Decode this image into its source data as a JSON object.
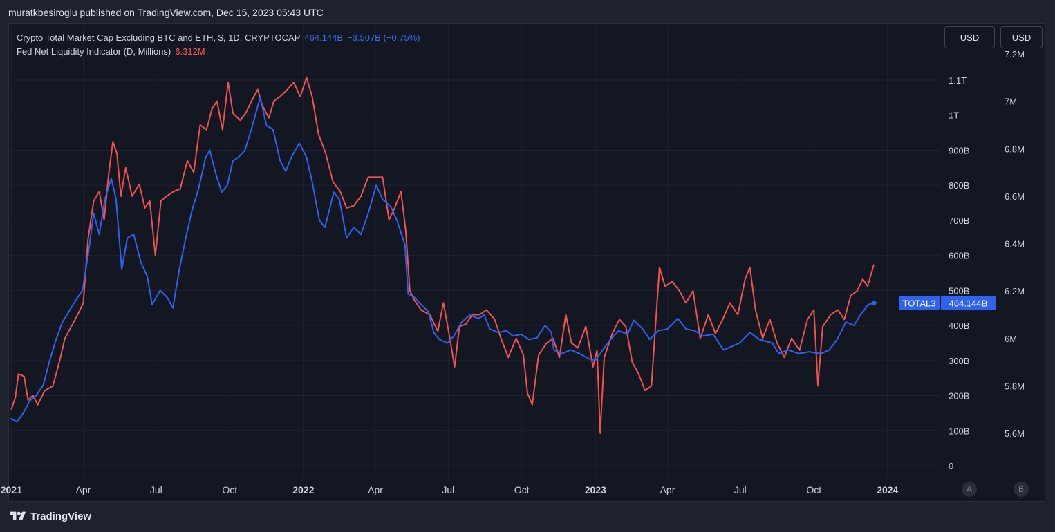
{
  "header": {
    "published": "muratkbesiroglu published on TradingView.com, Dec 15, 2023 05:43 UTC"
  },
  "legend": {
    "total3_name": "Crypto Total Market Cap Excluding BTC and ETH, $, 1D, CRYPTOCAP",
    "total3_value": "464.144B",
    "total3_change": "−3.507B (−0.75%)",
    "fed_name": "Fed Net Liquidity Indicator (D, Millions)",
    "fed_value": "6.312M"
  },
  "currency_buttons": [
    "USD",
    "USD"
  ],
  "price_tag": {
    "symbol": "TOTAL3",
    "value": "464.144B"
  },
  "scale_buttons": [
    "A",
    "B"
  ],
  "footer": {
    "brand": "TradingView"
  },
  "colors": {
    "total3": "#2f62f0",
    "fed": "#f25252",
    "background": "#131722",
    "grid": "#1f2330"
  },
  "chart_data": {
    "type": "line",
    "x_ticks": [
      "2021",
      "Apr",
      "Jul",
      "Oct",
      "2022",
      "Apr",
      "Jul",
      "Oct",
      "2023",
      "Apr",
      "Jul",
      "Oct",
      "2024"
    ],
    "x_tick_bold": [
      true,
      false,
      false,
      false,
      true,
      false,
      false,
      false,
      true,
      false,
      false,
      false,
      true
    ],
    "left_axis": {
      "label": "TOTAL3",
      "ticks": [
        "1.1T",
        "1T",
        "900B",
        "800B",
        "700B",
        "600B",
        "500B",
        "400B",
        "300B",
        "200B",
        "100B",
        "0"
      ],
      "range_billions": [
        0,
        1100
      ]
    },
    "right_axis": {
      "label": "Fed Net Liquidity",
      "ticks": [
        "7.2M",
        "7M",
        "6.8M",
        "6.6M",
        "6.4M",
        "6.2M",
        "6M",
        "5.8M",
        "5.6M"
      ],
      "range_millions": [
        5.6,
        7.2
      ]
    },
    "series": [
      {
        "name": "Crypto Total Market Cap Excluding BTC and ETH",
        "axis": "left",
        "unit": "B USD",
        "points": [
          [
            "2020-12-31",
            135
          ],
          [
            "2021-01-08",
            125
          ],
          [
            "2021-01-16",
            150
          ],
          [
            "2021-01-24",
            185
          ],
          [
            "2021-02-01",
            200
          ],
          [
            "2021-02-10",
            230
          ],
          [
            "2021-02-18",
            300
          ],
          [
            "2021-02-26",
            360
          ],
          [
            "2021-03-06",
            410
          ],
          [
            "2021-03-14",
            440
          ],
          [
            "2021-03-22",
            470
          ],
          [
            "2021-03-31",
            500
          ],
          [
            "2021-04-07",
            600
          ],
          [
            "2021-04-14",
            720
          ],
          [
            "2021-04-21",
            660
          ],
          [
            "2021-04-28",
            760
          ],
          [
            "2021-05-06",
            820
          ],
          [
            "2021-05-12",
            760
          ],
          [
            "2021-05-19",
            560
          ],
          [
            "2021-05-26",
            650
          ],
          [
            "2021-06-03",
            660
          ],
          [
            "2021-06-12",
            580
          ],
          [
            "2021-06-20",
            540
          ],
          [
            "2021-06-26",
            460
          ],
          [
            "2021-07-06",
            500
          ],
          [
            "2021-07-15",
            480
          ],
          [
            "2021-07-22",
            450
          ],
          [
            "2021-07-30",
            560
          ],
          [
            "2021-08-07",
            650
          ],
          [
            "2021-08-15",
            730
          ],
          [
            "2021-08-23",
            790
          ],
          [
            "2021-09-01",
            880
          ],
          [
            "2021-09-06",
            900
          ],
          [
            "2021-09-14",
            830
          ],
          [
            "2021-09-21",
            780
          ],
          [
            "2021-09-28",
            800
          ],
          [
            "2021-10-05",
            870
          ],
          [
            "2021-10-12",
            880
          ],
          [
            "2021-10-20",
            900
          ],
          [
            "2021-10-28",
            960
          ],
          [
            "2021-11-08",
            1050
          ],
          [
            "2021-11-16",
            970
          ],
          [
            "2021-11-24",
            960
          ],
          [
            "2021-12-03",
            870
          ],
          [
            "2021-12-10",
            840
          ],
          [
            "2021-12-17",
            880
          ],
          [
            "2021-12-27",
            920
          ],
          [
            "2022-01-05",
            880
          ],
          [
            "2022-01-12",
            810
          ],
          [
            "2022-01-21",
            700
          ],
          [
            "2022-01-28",
            680
          ],
          [
            "2022-02-08",
            780
          ],
          [
            "2022-02-15",
            760
          ],
          [
            "2022-02-24",
            650
          ],
          [
            "2022-03-05",
            680
          ],
          [
            "2022-03-14",
            660
          ],
          [
            "2022-03-23",
            720
          ],
          [
            "2022-04-02",
            800
          ],
          [
            "2022-04-10",
            760
          ],
          [
            "2022-04-20",
            740
          ],
          [
            "2022-04-28",
            700
          ],
          [
            "2022-05-08",
            630
          ],
          [
            "2022-05-12",
            490
          ],
          [
            "2022-05-20",
            480
          ],
          [
            "2022-05-28",
            460
          ],
          [
            "2022-06-06",
            440
          ],
          [
            "2022-06-13",
            380
          ],
          [
            "2022-06-20",
            360
          ],
          [
            "2022-06-30",
            350
          ],
          [
            "2022-07-08",
            370
          ],
          [
            "2022-07-18",
            410
          ],
          [
            "2022-07-28",
            430
          ],
          [
            "2022-08-08",
            420
          ],
          [
            "2022-08-15",
            430
          ],
          [
            "2022-08-22",
            390
          ],
          [
            "2022-09-01",
            380
          ],
          [
            "2022-09-12",
            385
          ],
          [
            "2022-09-20",
            370
          ],
          [
            "2022-09-30",
            375
          ],
          [
            "2022-10-10",
            360
          ],
          [
            "2022-10-20",
            365
          ],
          [
            "2022-10-30",
            400
          ],
          [
            "2022-11-07",
            380
          ],
          [
            "2022-11-10",
            330
          ],
          [
            "2022-11-20",
            320
          ],
          [
            "2022-12-01",
            330
          ],
          [
            "2022-12-12",
            320
          ],
          [
            "2022-12-24",
            305
          ],
          [
            "2023-01-01",
            300
          ],
          [
            "2023-01-10",
            330
          ],
          [
            "2023-01-20",
            360
          ],
          [
            "2023-01-30",
            385
          ],
          [
            "2023-02-10",
            375
          ],
          [
            "2023-02-18",
            415
          ],
          [
            "2023-03-01",
            390
          ],
          [
            "2023-03-10",
            360
          ],
          [
            "2023-03-20",
            385
          ],
          [
            "2023-04-01",
            390
          ],
          [
            "2023-04-14",
            420
          ],
          [
            "2023-04-24",
            390
          ],
          [
            "2023-05-05",
            385
          ],
          [
            "2023-05-15",
            370
          ],
          [
            "2023-05-28",
            375
          ],
          [
            "2023-06-10",
            330
          ],
          [
            "2023-06-20",
            340
          ],
          [
            "2023-06-30",
            350
          ],
          [
            "2023-07-13",
            380
          ],
          [
            "2023-07-25",
            360
          ],
          [
            "2023-08-10",
            350
          ],
          [
            "2023-08-18",
            320
          ],
          [
            "2023-08-30",
            330
          ],
          [
            "2023-09-12",
            320
          ],
          [
            "2023-09-25",
            325
          ],
          [
            "2023-10-10",
            320
          ],
          [
            "2023-10-20",
            330
          ],
          [
            "2023-10-30",
            360
          ],
          [
            "2023-11-10",
            410
          ],
          [
            "2023-11-20",
            400
          ],
          [
            "2023-11-28",
            430
          ],
          [
            "2023-12-08",
            460
          ],
          [
            "2023-12-15",
            464.144
          ]
        ]
      },
      {
        "name": "Fed Net Liquidity Indicator",
        "axis": "right",
        "unit": "M USD",
        "points": [
          [
            "2021-01-01",
            5.7
          ],
          [
            "2021-01-06",
            5.75
          ],
          [
            "2021-01-10",
            5.85
          ],
          [
            "2021-01-17",
            5.84
          ],
          [
            "2021-01-22",
            5.74
          ],
          [
            "2021-01-28",
            5.76
          ],
          [
            "2021-02-03",
            5.72
          ],
          [
            "2021-02-12",
            5.78
          ],
          [
            "2021-02-22",
            5.8
          ],
          [
            "2021-03-02",
            5.9
          ],
          [
            "2021-03-09",
            6.0
          ],
          [
            "2021-03-17",
            6.05
          ],
          [
            "2021-03-25",
            6.1
          ],
          [
            "2021-04-01",
            6.15
          ],
          [
            "2021-04-07",
            6.42
          ],
          [
            "2021-04-14",
            6.58
          ],
          [
            "2021-04-21",
            6.62
          ],
          [
            "2021-04-27",
            6.5
          ],
          [
            "2021-05-03",
            6.7
          ],
          [
            "2021-05-08",
            6.83
          ],
          [
            "2021-05-13",
            6.78
          ],
          [
            "2021-05-18",
            6.6
          ],
          [
            "2021-05-24",
            6.72
          ],
          [
            "2021-06-01",
            6.6
          ],
          [
            "2021-06-10",
            6.65
          ],
          [
            "2021-06-17",
            6.55
          ],
          [
            "2021-06-23",
            6.58
          ],
          [
            "2021-06-30",
            6.35
          ],
          [
            "2021-07-07",
            6.58
          ],
          [
            "2021-07-14",
            6.6
          ],
          [
            "2021-07-23",
            6.62
          ],
          [
            "2021-07-31",
            6.63
          ],
          [
            "2021-08-09",
            6.75
          ],
          [
            "2021-08-17",
            6.7
          ],
          [
            "2021-08-25",
            6.9
          ],
          [
            "2021-09-02",
            6.88
          ],
          [
            "2021-09-09",
            6.97
          ],
          [
            "2021-09-15",
            7.0
          ],
          [
            "2021-09-22",
            6.88
          ],
          [
            "2021-09-29",
            7.08
          ],
          [
            "2021-10-05",
            6.95
          ],
          [
            "2021-10-14",
            6.92
          ],
          [
            "2021-10-21",
            6.95
          ],
          [
            "2021-10-28",
            7.0
          ],
          [
            "2021-11-05",
            7.05
          ],
          [
            "2021-11-11",
            6.98
          ],
          [
            "2021-11-19",
            6.93
          ],
          [
            "2021-11-25",
            7.0
          ],
          [
            "2021-12-03",
            7.02
          ],
          [
            "2021-12-12",
            7.05
          ],
          [
            "2021-12-20",
            7.08
          ],
          [
            "2021-12-28",
            7.02
          ],
          [
            "2022-01-05",
            7.1
          ],
          [
            "2022-01-12",
            7.02
          ],
          [
            "2022-01-20",
            6.86
          ],
          [
            "2022-01-29",
            6.78
          ],
          [
            "2022-02-07",
            6.66
          ],
          [
            "2022-02-16",
            6.62
          ],
          [
            "2022-02-24",
            6.55
          ],
          [
            "2022-03-05",
            6.56
          ],
          [
            "2022-03-14",
            6.6
          ],
          [
            "2022-03-23",
            6.68
          ],
          [
            "2022-04-02",
            6.68
          ],
          [
            "2022-04-10",
            6.68
          ],
          [
            "2022-04-18",
            6.5
          ],
          [
            "2022-04-25",
            6.55
          ],
          [
            "2022-05-03",
            6.62
          ],
          [
            "2022-05-09",
            6.45
          ],
          [
            "2022-05-14",
            6.2
          ],
          [
            "2022-05-20",
            6.16
          ],
          [
            "2022-05-28",
            6.12
          ],
          [
            "2022-06-08",
            6.1
          ],
          [
            "2022-06-18",
            6.03
          ],
          [
            "2022-06-25",
            6.15
          ],
          [
            "2022-07-02",
            6.02
          ],
          [
            "2022-07-09",
            5.88
          ],
          [
            "2022-07-15",
            6.05
          ],
          [
            "2022-07-23",
            6.06
          ],
          [
            "2022-07-31",
            6.1
          ],
          [
            "2022-08-09",
            6.1
          ],
          [
            "2022-08-18",
            6.12
          ],
          [
            "2022-08-28",
            6.08
          ],
          [
            "2022-09-05",
            6.0
          ],
          [
            "2022-09-14",
            5.92
          ],
          [
            "2022-09-24",
            6.0
          ],
          [
            "2022-10-03",
            5.93
          ],
          [
            "2022-10-08",
            5.77
          ],
          [
            "2022-10-14",
            5.72
          ],
          [
            "2022-10-22",
            5.93
          ],
          [
            "2022-11-01",
            5.98
          ],
          [
            "2022-11-09",
            6.0
          ],
          [
            "2022-11-17",
            5.92
          ],
          [
            "2022-11-25",
            6.1
          ],
          [
            "2022-12-02",
            5.98
          ],
          [
            "2022-12-10",
            5.96
          ],
          [
            "2022-12-20",
            6.05
          ],
          [
            "2022-12-29",
            5.88
          ],
          [
            "2023-01-03",
            5.95
          ],
          [
            "2023-01-07",
            5.6
          ],
          [
            "2023-01-12",
            5.92
          ],
          [
            "2023-01-22",
            6.02
          ],
          [
            "2023-01-31",
            6.08
          ],
          [
            "2023-02-08",
            6.05
          ],
          [
            "2023-02-16",
            5.9
          ],
          [
            "2023-02-24",
            5.85
          ],
          [
            "2023-03-04",
            5.78
          ],
          [
            "2023-03-12",
            5.8
          ],
          [
            "2023-03-17",
            6.05
          ],
          [
            "2023-03-22",
            6.3
          ],
          [
            "2023-03-29",
            6.22
          ],
          [
            "2023-04-07",
            6.24
          ],
          [
            "2023-04-16",
            6.2
          ],
          [
            "2023-04-24",
            6.15
          ],
          [
            "2023-05-03",
            6.2
          ],
          [
            "2023-05-12",
            6.0
          ],
          [
            "2023-05-22",
            6.1
          ],
          [
            "2023-05-31",
            6.02
          ],
          [
            "2023-06-09",
            6.08
          ],
          [
            "2023-06-18",
            6.15
          ],
          [
            "2023-06-28",
            6.1
          ],
          [
            "2023-07-07",
            6.25
          ],
          [
            "2023-07-13",
            6.3
          ],
          [
            "2023-07-20",
            6.12
          ],
          [
            "2023-07-29",
            6.0
          ],
          [
            "2023-08-07",
            6.08
          ],
          [
            "2023-08-16",
            5.98
          ],
          [
            "2023-08-25",
            5.92
          ],
          [
            "2023-09-03",
            6.0
          ],
          [
            "2023-09-13",
            5.95
          ],
          [
            "2023-09-23",
            6.08
          ],
          [
            "2023-10-01",
            6.12
          ],
          [
            "2023-10-06",
            5.8
          ],
          [
            "2023-10-12",
            6.05
          ],
          [
            "2023-10-22",
            6.1
          ],
          [
            "2023-10-31",
            6.12
          ],
          [
            "2023-11-08",
            6.08
          ],
          [
            "2023-11-16",
            6.18
          ],
          [
            "2023-11-24",
            6.2
          ],
          [
            "2023-12-01",
            6.25
          ],
          [
            "2023-12-07",
            6.22
          ],
          [
            "2023-12-15",
            6.312
          ]
        ]
      }
    ]
  }
}
